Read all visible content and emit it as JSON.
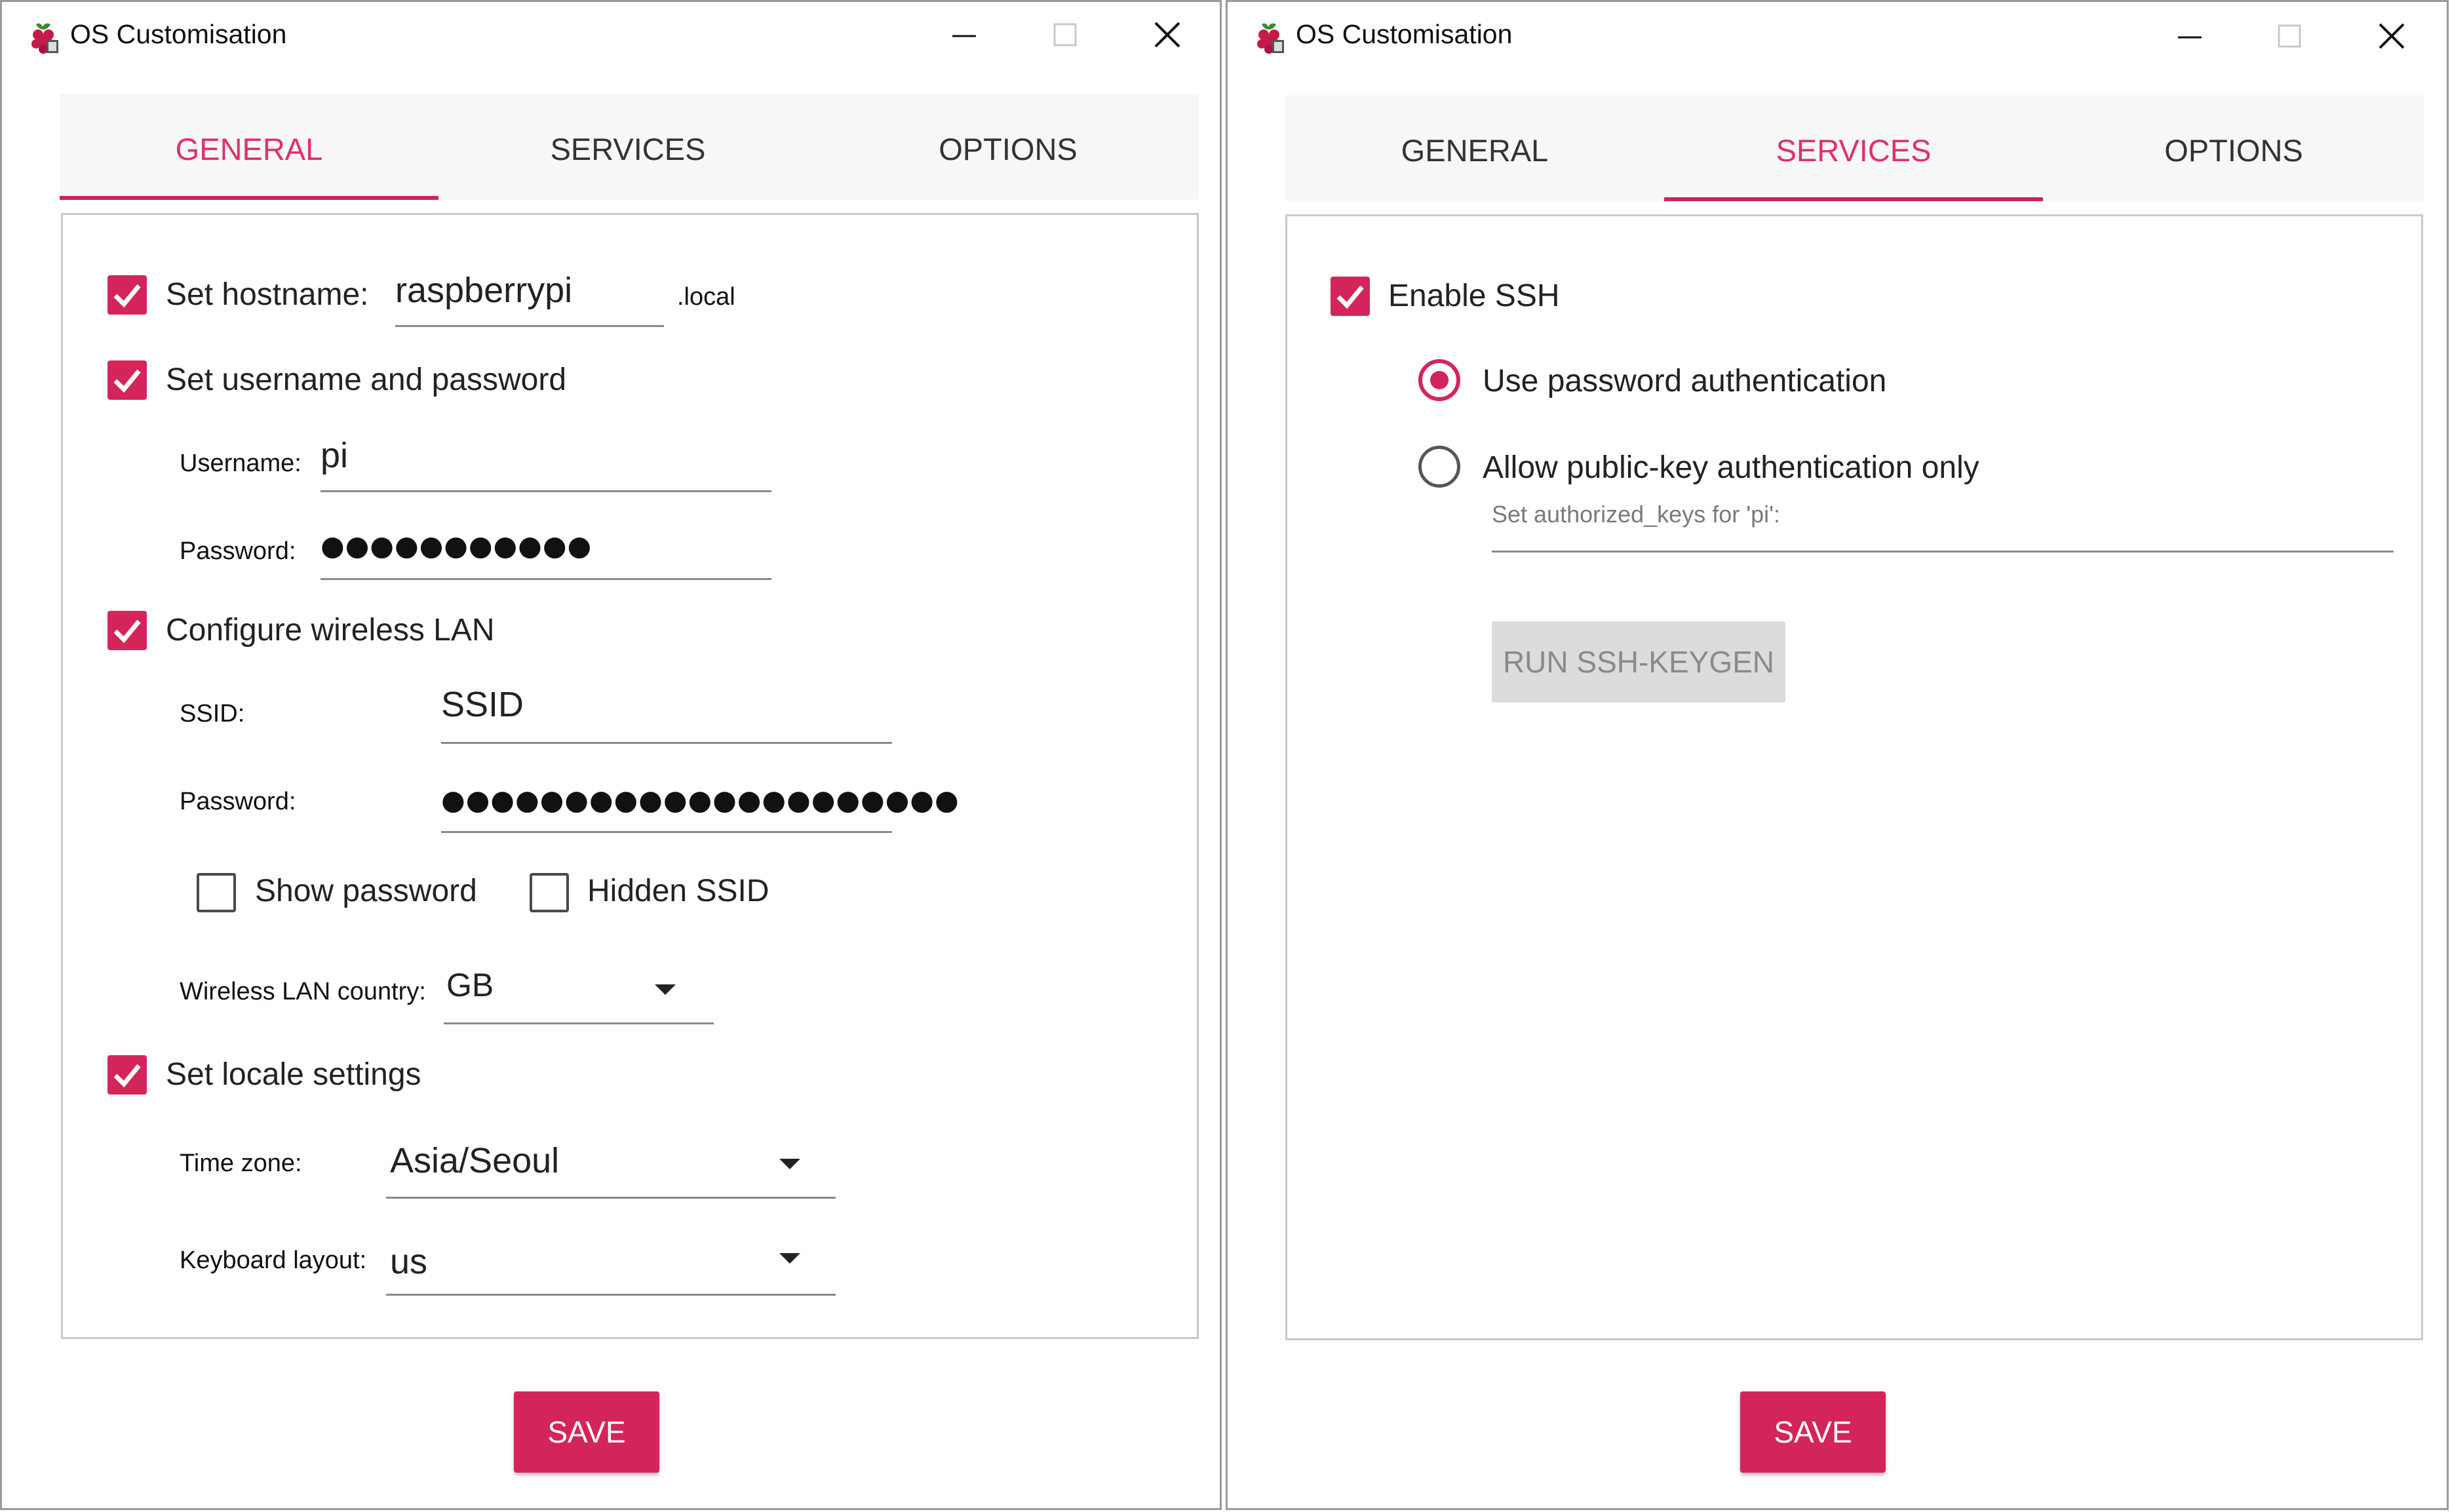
{
  "window_title": "OS Customisation",
  "tabs": [
    "GENERAL",
    "SERVICES",
    "OPTIONS"
  ],
  "accent_color": "#d3255a",
  "general": {
    "hostname": {
      "checked": true,
      "label": "Set hostname:",
      "value": "raspberrypi",
      "suffix": ".local"
    },
    "user": {
      "checked": true,
      "label": "Set username and password",
      "username_label": "Username:",
      "username_value": "pi",
      "password_label": "Password:",
      "password_mask": "●●●●●●●●●●●"
    },
    "wifi": {
      "checked": true,
      "label": "Configure wireless LAN",
      "ssid_label": "SSID:",
      "ssid_value": "SSID",
      "password_label": "Password:",
      "password_mask": "●●●●●●●●●●●●●●●●●●●●●",
      "show_password_label": "Show password",
      "hidden_ssid_label": "Hidden SSID",
      "country_label": "Wireless LAN country:",
      "country_value": "GB"
    },
    "locale": {
      "checked": true,
      "label": "Set locale settings",
      "timezone_label": "Time zone:",
      "timezone_value": "Asia/Seoul",
      "keyboard_label": "Keyboard layout:",
      "keyboard_value": "us"
    }
  },
  "services": {
    "ssh": {
      "checked": true,
      "label": "Enable SSH"
    },
    "password_auth_label": "Use password authentication",
    "pubkey_auth_label": "Allow public-key authentication only",
    "authorized_keys_label": "Set authorized_keys for 'pi':",
    "keygen_button": "RUN SSH-KEYGEN"
  },
  "save_button": "SAVE",
  "icons": [
    "raspberry-pi-icon",
    "minimize-icon",
    "maximize-icon",
    "close-icon",
    "checkmark-icon",
    "dropdown-arrow-icon"
  ]
}
